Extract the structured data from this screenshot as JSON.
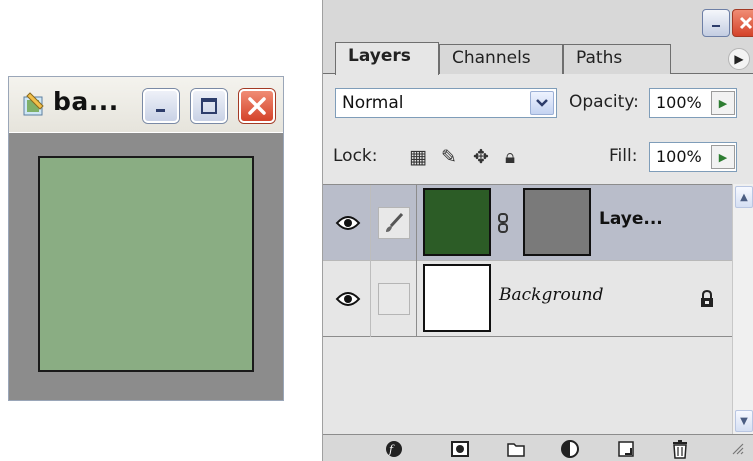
{
  "document_window": {
    "title": "ba...",
    "minimize_label": "",
    "maximize_label": "",
    "close_label": "",
    "canvas_colors": {
      "border_area": "#8c8c8c",
      "swatch": "#8aad83"
    }
  },
  "layers_palette": {
    "tabs": [
      {
        "label": "Layers",
        "active": true
      },
      {
        "label": "Channels",
        "active": false
      },
      {
        "label": "Paths",
        "active": false
      }
    ],
    "blend_mode": "Normal",
    "opacity_label": "Opacity:",
    "opacity_value": "100%",
    "lock_label": "Lock:",
    "fill_label": "Fill:",
    "fill_value": "100%",
    "layers": [
      {
        "name": "Laye...",
        "selected": true,
        "visible": true,
        "thumb_color": "#2c5c26",
        "mask_color": "#7a7a7a",
        "has_mask": true,
        "locked": false
      },
      {
        "name": "Background",
        "selected": false,
        "visible": true,
        "thumb_color": "#ffffff",
        "has_mask": false,
        "locked": true
      }
    ],
    "bottom_tools": [
      "link-layers-icon",
      "layer-style-icon",
      "add-mask-icon",
      "new-group-icon",
      "adjustment-layer-icon",
      "new-layer-icon",
      "delete-layer-icon"
    ]
  }
}
